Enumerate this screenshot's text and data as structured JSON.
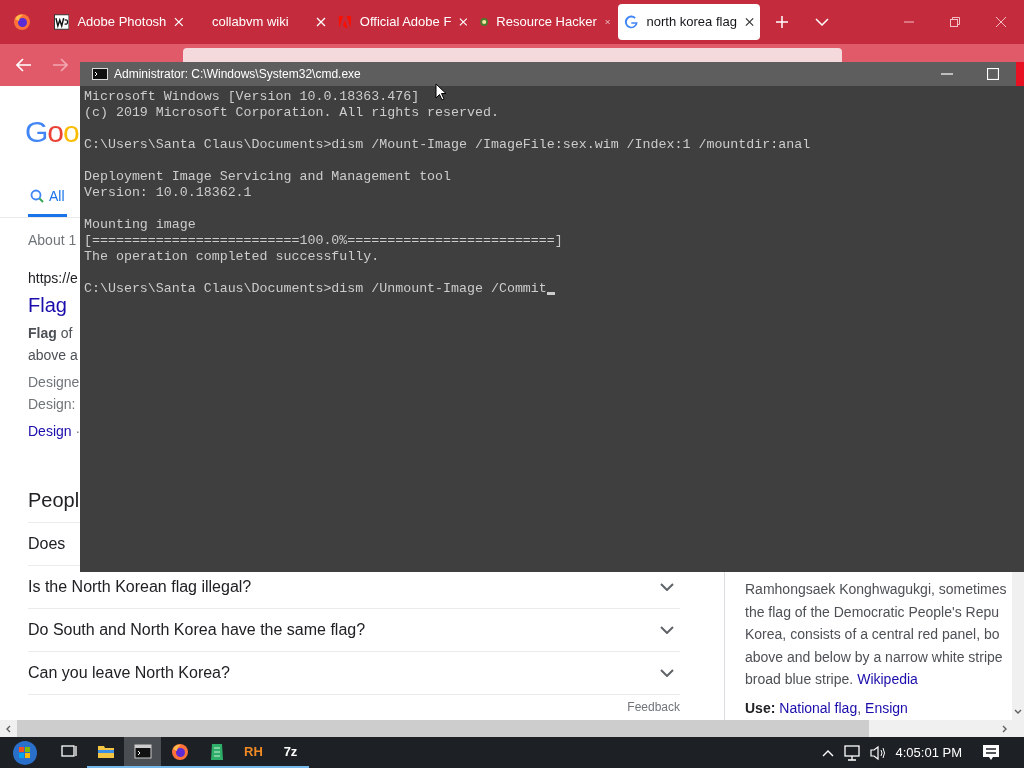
{
  "browser": {
    "tabs": [
      {
        "kind": "letters",
        "title": "Adobe Photosh",
        "selected": false
      },
      {
        "kind": "blank",
        "title": "collabvm wiki",
        "selected": false
      },
      {
        "kind": "adobe",
        "title": "Official Adobe F",
        "selected": false
      },
      {
        "kind": "badge",
        "title": "Resource Hacker",
        "selected": false
      },
      {
        "kind": "google",
        "title": "north korea flag",
        "selected": true
      }
    ],
    "forward_disabled": true
  },
  "google": {
    "logo": "Goo",
    "nav": [
      {
        "label": "All",
        "selected": true
      }
    ],
    "stats": "About 1",
    "result": {
      "url": "https://e",
      "title": "Flag",
      "snippet_lines": [
        "**Flag** of",
        "above a"
      ],
      "fact_label": "Designe",
      "design": "Design:",
      "sitelinks": [
        "Design"
      ],
      "separator": "·"
    },
    "people_also_ask": {
      "title": "Peopl",
      "questions": [
        "Does",
        "Is the North Korean flag illegal?",
        "Do South and North Korea have the same flag?",
        "Can you leave North Korea?"
      ],
      "feedback": "Feedback"
    },
    "panel": {
      "lines": [
        "Ramhongsaek Konghwagukgi, sometimes",
        "the flag of the Democratic People's Repu",
        "Korea, consists of a central red panel, bo",
        "above and below by a narrow white stripe",
        "broad blue stripe."
      ],
      "source": "Wikipedia",
      "use_label": "Use:",
      "use_links": [
        "National flag",
        "Ensign"
      ],
      "use_separator": ","
    }
  },
  "cmd": {
    "title": "Administrator: C:\\Windows\\System32\\cmd.exe",
    "cursor": true,
    "blocks": [
      [
        "Microsoft Windows [Version 10.0.18363.476]",
        "(c) 2019 Microsoft Corporation. All rights reserved."
      ],
      [
        "C:\\Users\\Santa Claus\\Documents>dism /Mount-Image /ImageFile:sex.wim /Index:1 /mountdir:anal"
      ],
      [
        "Deployment Image Servicing and Management tool",
        "Version: 10.0.18362.1"
      ],
      [
        "Mounting image",
        "[==========================100.0%==========================]",
        "The operation completed successfully."
      ],
      [
        "C:\\Users\\Santa Claus\\Documents>dism /Unmount-Image /Commit"
      ]
    ]
  },
  "taskbar": {
    "apps": [
      {
        "kind": "task-view",
        "running": false,
        "active": false
      },
      {
        "kind": "folder",
        "running": true,
        "active": false
      },
      {
        "kind": "console",
        "running": true,
        "active": true
      },
      {
        "kind": "firefox",
        "running": true,
        "active": false
      },
      {
        "kind": "sheet",
        "running": true,
        "active": false
      },
      {
        "kind": "text",
        "label": "RH",
        "running": true,
        "active": false
      },
      {
        "kind": "text",
        "label": "7z",
        "running": true,
        "active": false
      }
    ],
    "clock": "4:05:01 PM"
  }
}
